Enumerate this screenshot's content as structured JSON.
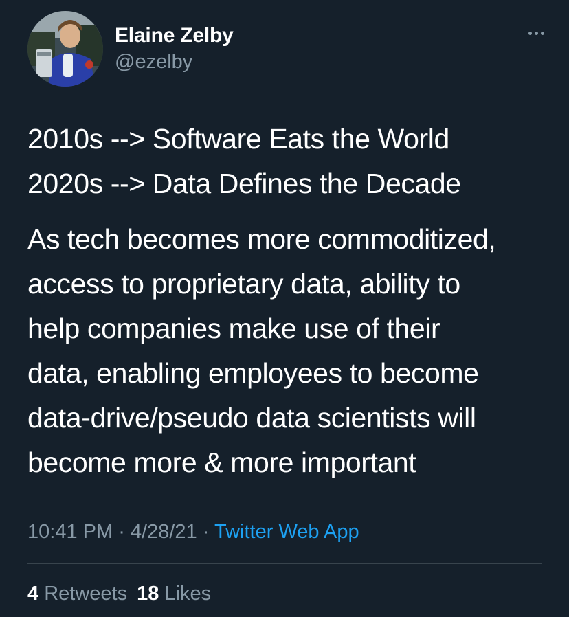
{
  "author": {
    "display_name": "Elaine Zelby",
    "handle": "@ezelby"
  },
  "tweet": {
    "lines_para1": [
      "2010s --> Software Eats the World",
      "2020s --> Data Defines the Decade"
    ],
    "lines_para2": [
      "As tech becomes more commoditized,",
      "access to proprietary data, ability to",
      "help companies make use of their",
      "data, enabling employees to become",
      "data-drive/pseudo data scientists will",
      "become more & more important"
    ]
  },
  "meta": {
    "time": "10:41 PM",
    "separator": "·",
    "date": "4/28/21",
    "source": "Twitter Web App"
  },
  "stats": {
    "retweets_count": "4",
    "retweets_label": "Retweets",
    "likes_count": "18",
    "likes_label": "Likes"
  },
  "icons": {
    "more": "more-horizontal-icon"
  },
  "colors": {
    "background": "#15202b",
    "primary_text": "#ffffff",
    "secondary_text": "#8899a6",
    "link": "#1da1f2",
    "divider": "#38444d"
  }
}
